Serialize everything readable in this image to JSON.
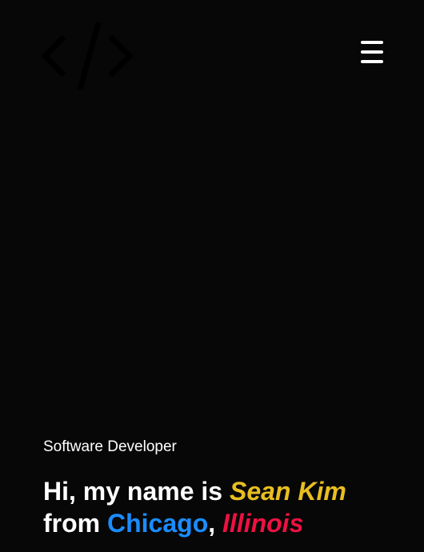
{
  "header": {
    "logo_icon": "code-brackets-icon",
    "menu_icon": "hamburger-menu-icon"
  },
  "hero": {
    "role": "Software Developer",
    "line1_prefix": "Hi, my name is ",
    "name": "Sean Kim",
    "line2_prefix": "from ",
    "city": "Chicago",
    "separator": ", ",
    "state": "Illinois"
  },
  "colors": {
    "background": "#070707",
    "text": "#ffffff",
    "name_accent": "#e8be20",
    "city_accent": "#1a8cff",
    "state_accent": "#ee1142"
  }
}
